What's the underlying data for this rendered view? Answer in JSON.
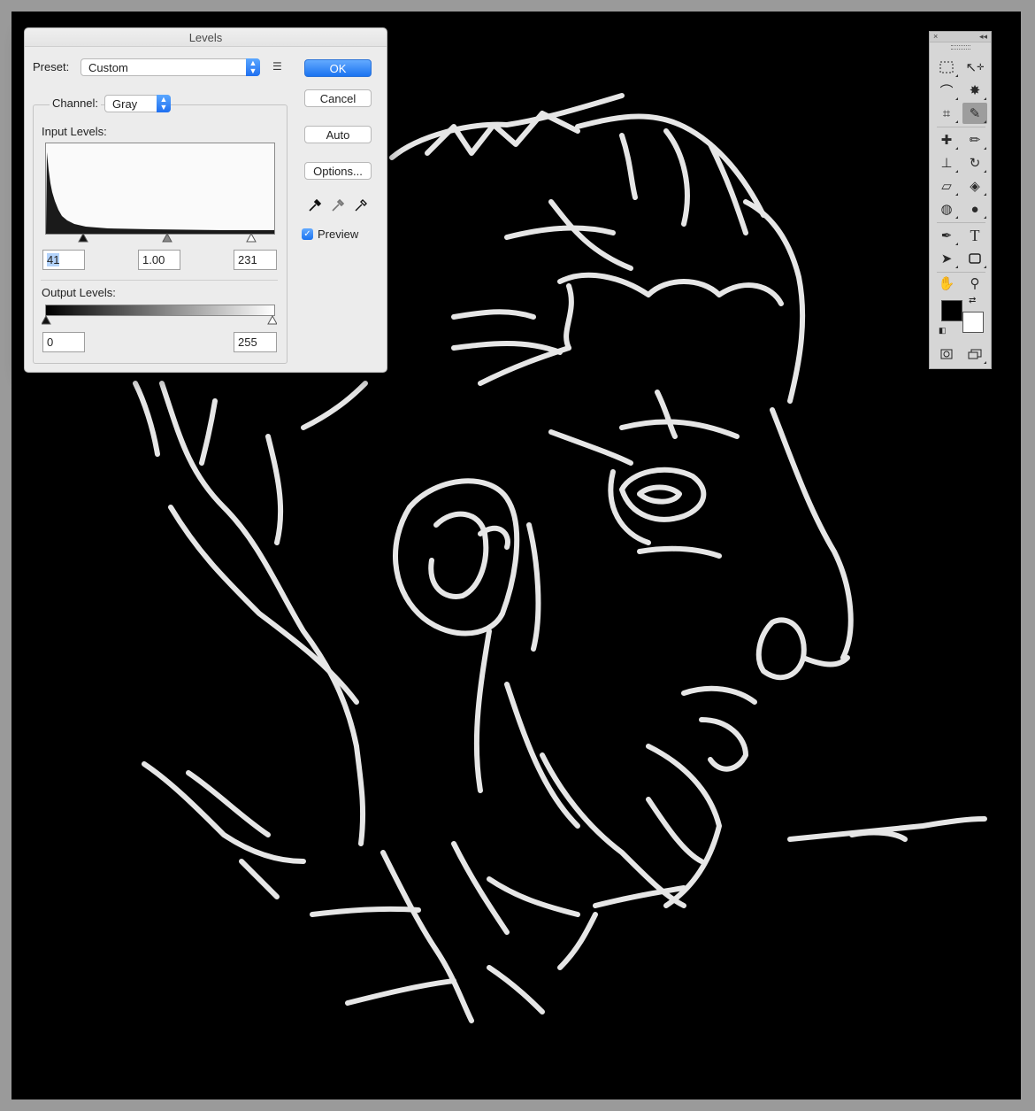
{
  "dialog": {
    "title": "Levels",
    "preset_label": "Preset:",
    "preset_value": "Custom",
    "channel_label": "Channel:",
    "channel_value": "Gray",
    "input_levels_label": "Input Levels:",
    "input_black": "41",
    "input_gamma": "1.00",
    "input_white": "231",
    "output_levels_label": "Output Levels:",
    "output_black": "0",
    "output_white": "255",
    "buttons": {
      "ok": "OK",
      "cancel": "Cancel",
      "auto": "Auto",
      "options": "Options..."
    },
    "preview_label": "Preview",
    "preview_checked": true
  },
  "tools_panel": {
    "collapse_label": "◂◂",
    "close_label": "×",
    "tools": [
      [
        "rect-marquee-icon",
        "lasso-icon"
      ],
      [
        "move-icon",
        "quick-select-icon"
      ],
      [
        "crop-icon",
        "eyedropper-icon"
      ],
      [
        "spot-healing-icon",
        "brush-icon"
      ],
      [
        "clone-stamp-icon",
        "history-brush-icon"
      ],
      [
        "eraser-icon",
        "paint-bucket-icon"
      ],
      [
        "blur-icon",
        "dodge-icon"
      ],
      [
        "pen-icon",
        "type-icon"
      ],
      [
        "path-select-icon",
        "rectangle-shape-icon"
      ],
      [
        "hand-icon",
        "zoom-icon"
      ]
    ],
    "foreground_color": "#000000",
    "background_color": "#ffffff",
    "active_tool": "eyedropper-icon",
    "type_tool_glyph": "T"
  },
  "colors": {
    "accent": "#1b73f0",
    "canvas": "#000000",
    "sketch_line": "#e6e6e6"
  }
}
